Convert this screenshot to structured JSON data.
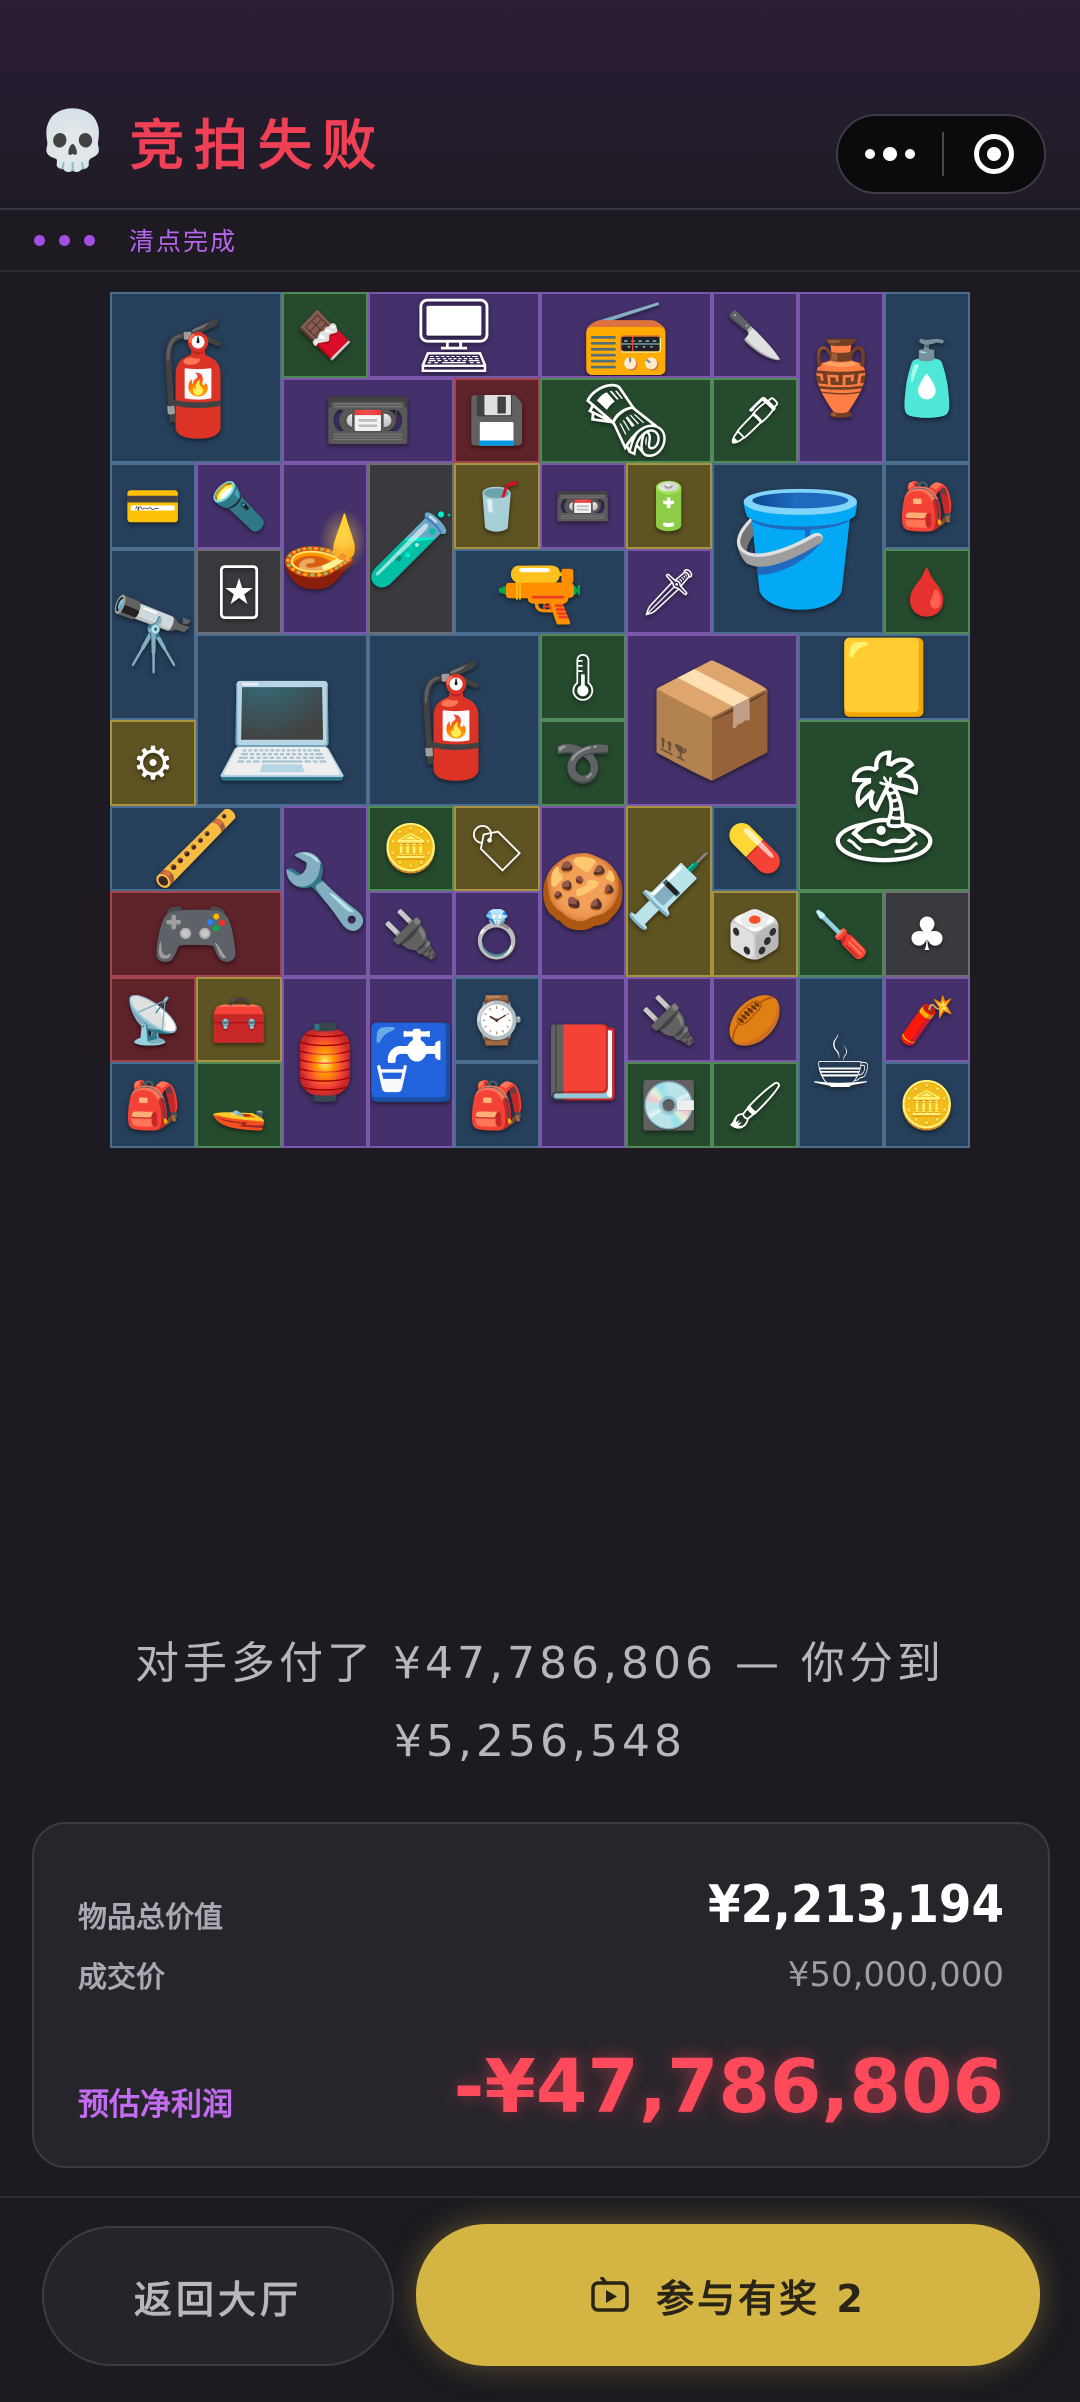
{
  "header": {
    "title": "竞拍失败",
    "skull_icon": "💀",
    "status_text": "清点完成"
  },
  "grid": {
    "items": [
      {
        "c": 0,
        "r": 0,
        "w": 2,
        "h": 2,
        "color": "blue",
        "icon": "🧯",
        "name": "gas-cylinder"
      },
      {
        "c": 2,
        "r": 0,
        "w": 1,
        "h": 1,
        "color": "green",
        "icon": "🍫",
        "name": "energy-bar"
      },
      {
        "c": 3,
        "r": 0,
        "w": 2,
        "h": 1,
        "color": "purple",
        "icon": "🖥",
        "name": "graphics-card"
      },
      {
        "c": 5,
        "r": 0,
        "w": 2,
        "h": 1,
        "color": "purple",
        "icon": "📻",
        "name": "radio"
      },
      {
        "c": 7,
        "r": 0,
        "w": 1,
        "h": 1,
        "color": "purple",
        "icon": "🔪",
        "name": "knife"
      },
      {
        "c": 8,
        "r": 0,
        "w": 1,
        "h": 2,
        "color": "purple",
        "icon": "🏺",
        "name": "gold-teapot"
      },
      {
        "c": 9,
        "r": 0,
        "w": 1,
        "h": 2,
        "color": "blue",
        "icon": "🧴",
        "name": "black-powder"
      },
      {
        "c": 2,
        "r": 1,
        "w": 2,
        "h": 1,
        "color": "purple",
        "icon": "📼",
        "name": "boombox"
      },
      {
        "c": 4,
        "r": 1,
        "w": 1,
        "h": 1,
        "color": "red",
        "icon": "💾",
        "name": "usb-drive"
      },
      {
        "c": 5,
        "r": 1,
        "w": 2,
        "h": 1,
        "color": "green",
        "icon": "🗞",
        "name": "old-paper"
      },
      {
        "c": 7,
        "r": 1,
        "w": 1,
        "h": 1,
        "color": "green",
        "icon": "🖊",
        "name": "pen"
      },
      {
        "c": 0,
        "r": 2,
        "w": 1,
        "h": 1,
        "color": "blue",
        "icon": "💳",
        "name": "memory-card"
      },
      {
        "c": 1,
        "r": 2,
        "w": 1,
        "h": 1,
        "color": "purple",
        "icon": "🔦",
        "name": "flashlight"
      },
      {
        "c": 2,
        "r": 2,
        "w": 1,
        "h": 2,
        "color": "purple",
        "icon": "🪔",
        "name": "hookah"
      },
      {
        "c": 3,
        "r": 2,
        "w": 1,
        "h": 2,
        "color": "gray",
        "icon": "🧪",
        "name": "chemical-bottle"
      },
      {
        "c": 4,
        "r": 2,
        "w": 1,
        "h": 1,
        "color": "gold",
        "icon": "🥤",
        "name": "drink-bottle"
      },
      {
        "c": 5,
        "r": 2,
        "w": 1,
        "h": 1,
        "color": "purple",
        "icon": "📼",
        "name": "cassette"
      },
      {
        "c": 6,
        "r": 2,
        "w": 1,
        "h": 1,
        "color": "gold",
        "icon": "🔋",
        "name": "ssd"
      },
      {
        "c": 7,
        "r": 2,
        "w": 2,
        "h": 2,
        "color": "blue",
        "icon": "🪣",
        "name": "paint-bucket"
      },
      {
        "c": 9,
        "r": 2,
        "w": 1,
        "h": 1,
        "color": "blue",
        "icon": "🎒",
        "name": "ration-pack"
      },
      {
        "c": 0,
        "r": 3,
        "w": 1,
        "h": 2,
        "color": "blue",
        "icon": "🔭",
        "name": "telescope"
      },
      {
        "c": 1,
        "r": 3,
        "w": 1,
        "h": 1,
        "color": "gray",
        "icon": "🃏",
        "name": "playing-card"
      },
      {
        "c": 4,
        "r": 3,
        "w": 2,
        "h": 1,
        "color": "blue",
        "icon": "🔫",
        "name": "rifle"
      },
      {
        "c": 6,
        "r": 3,
        "w": 1,
        "h": 1,
        "color": "purple",
        "icon": "🗡",
        "name": "spear-head"
      },
      {
        "c": 9,
        "r": 3,
        "w": 1,
        "h": 1,
        "color": "green",
        "icon": "🩸",
        "name": "blood-bag"
      },
      {
        "c": 1,
        "r": 4,
        "w": 2,
        "h": 2,
        "color": "blue",
        "icon": "💻",
        "name": "tablet-screen"
      },
      {
        "c": 3,
        "r": 4,
        "w": 2,
        "h": 2,
        "color": "blue",
        "icon": "🧯",
        "name": "gas-cylinder-2"
      },
      {
        "c": 5,
        "r": 4,
        "w": 1,
        "h": 1,
        "color": "green",
        "icon": "🌡",
        "name": "thermometer"
      },
      {
        "c": 6,
        "r": 4,
        "w": 2,
        "h": 2,
        "color": "purple",
        "icon": "📦",
        "name": "router"
      },
      {
        "c": 8,
        "r": 4,
        "w": 2,
        "h": 1,
        "color": "blue",
        "icon": "🟨",
        "name": "gold-bar"
      },
      {
        "c": 0,
        "r": 5,
        "w": 1,
        "h": 1,
        "color": "gold",
        "icon": "⚙",
        "name": "circuit-board"
      },
      {
        "c": 5,
        "r": 5,
        "w": 1,
        "h": 1,
        "color": "green",
        "icon": "➰",
        "name": "cable-coil"
      },
      {
        "c": 8,
        "r": 5,
        "w": 2,
        "h": 2,
        "color": "green",
        "icon": "🏝",
        "name": "vintage-poster"
      },
      {
        "c": 0,
        "r": 6,
        "w": 2,
        "h": 1,
        "color": "blue",
        "icon": "🪈",
        "name": "smoking-pipe"
      },
      {
        "c": 2,
        "r": 6,
        "w": 1,
        "h": 2,
        "color": "purple",
        "icon": "🔧",
        "name": "pipe-wrench"
      },
      {
        "c": 3,
        "r": 6,
        "w": 1,
        "h": 1,
        "color": "green",
        "icon": "🪙",
        "name": "old-coin"
      },
      {
        "c": 4,
        "r": 6,
        "w": 1,
        "h": 1,
        "color": "gold",
        "icon": "🏷",
        "name": "tag"
      },
      {
        "c": 5,
        "r": 6,
        "w": 1,
        "h": 2,
        "color": "purple",
        "icon": "🍪",
        "name": "gingerbread-man"
      },
      {
        "c": 6,
        "r": 6,
        "w": 1,
        "h": 2,
        "color": "gold",
        "icon": "💉",
        "name": "syringe-pack"
      },
      {
        "c": 7,
        "r": 6,
        "w": 1,
        "h": 1,
        "color": "blue",
        "icon": "💊",
        "name": "pill-bottle"
      },
      {
        "c": 0,
        "r": 7,
        "w": 2,
        "h": 1,
        "color": "red",
        "icon": "🎮",
        "name": "gpu"
      },
      {
        "c": 3,
        "r": 7,
        "w": 1,
        "h": 1,
        "color": "purple",
        "icon": "🔌",
        "name": "chip-device"
      },
      {
        "c": 4,
        "r": 7,
        "w": 1,
        "h": 1,
        "color": "purple",
        "icon": "💍",
        "name": "jewelry"
      },
      {
        "c": 7,
        "r": 7,
        "w": 1,
        "h": 1,
        "color": "gold",
        "icon": "🎲",
        "name": "companion-cube"
      },
      {
        "c": 8,
        "r": 7,
        "w": 1,
        "h": 1,
        "color": "green",
        "icon": "🪛",
        "name": "screwdriver"
      },
      {
        "c": 9,
        "r": 7,
        "w": 1,
        "h": 1,
        "color": "gray",
        "icon": "♣",
        "name": "ace-of-clubs"
      },
      {
        "c": 0,
        "r": 8,
        "w": 1,
        "h": 1,
        "color": "red",
        "icon": "📡",
        "name": "signal-module"
      },
      {
        "c": 1,
        "r": 8,
        "w": 1,
        "h": 1,
        "color": "gold",
        "icon": "🧰",
        "name": "amplifier"
      },
      {
        "c": 2,
        "r": 8,
        "w": 1,
        "h": 2,
        "color": "purple",
        "icon": "🏮",
        "name": "lantern"
      },
      {
        "c": 3,
        "r": 8,
        "w": 1,
        "h": 2,
        "color": "purple",
        "icon": "🚰",
        "name": "golden-faucet"
      },
      {
        "c": 4,
        "r": 8,
        "w": 1,
        "h": 1,
        "color": "blue",
        "icon": "⌚",
        "name": "smartwatch"
      },
      {
        "c": 5,
        "r": 8,
        "w": 1,
        "h": 2,
        "color": "purple",
        "icon": "📕",
        "name": "black-tide-book"
      },
      {
        "c": 6,
        "r": 8,
        "w": 1,
        "h": 1,
        "color": "purple",
        "icon": "🔌",
        "name": "connector"
      },
      {
        "c": 7,
        "r": 8,
        "w": 1,
        "h": 1,
        "color": "purple",
        "icon": "🏉",
        "name": "rugby-ball"
      },
      {
        "c": 8,
        "r": 8,
        "w": 1,
        "h": 2,
        "color": "blue",
        "icon": "☕",
        "name": "moka-pot"
      },
      {
        "c": 9,
        "r": 8,
        "w": 1,
        "h": 1,
        "color": "purple",
        "icon": "🧨",
        "name": "flare"
      },
      {
        "c": 0,
        "r": 9,
        "w": 1,
        "h": 1,
        "color": "blue",
        "icon": "🎒",
        "name": "ration-pack-2"
      },
      {
        "c": 1,
        "r": 9,
        "w": 1,
        "h": 1,
        "color": "green",
        "icon": "🚤",
        "name": "boat-model"
      },
      {
        "c": 4,
        "r": 9,
        "w": 1,
        "h": 1,
        "color": "blue",
        "icon": "🎒",
        "name": "ration-pack-3"
      },
      {
        "c": 6,
        "r": 9,
        "w": 1,
        "h": 1,
        "color": "green",
        "icon": "💽",
        "name": "hard-drive"
      },
      {
        "c": 7,
        "r": 9,
        "w": 1,
        "h": 1,
        "color": "green",
        "icon": "🖌",
        "name": "voltage-tester"
      },
      {
        "c": 9,
        "r": 9,
        "w": 1,
        "h": 1,
        "color": "blue",
        "icon": "🪙",
        "name": "silver-coin"
      }
    ]
  },
  "message": {
    "line1": "对手多付了 ¥47,786,806 — 你分到",
    "line2": "¥5,256,548"
  },
  "summary": {
    "total_label": "物品总价值",
    "total_value": "¥2,213,194",
    "deal_label": "成交价",
    "deal_value": "¥50,000,000",
    "profit_label": "预估净利润",
    "profit_value": "-¥47,786,806"
  },
  "buttons": {
    "back_label": "返回大厅",
    "join_label": "参与有奖 2"
  },
  "colors": {
    "accent_red": "#f04055",
    "accent_purple": "#b865ee",
    "button_gold": "#d4b443"
  }
}
